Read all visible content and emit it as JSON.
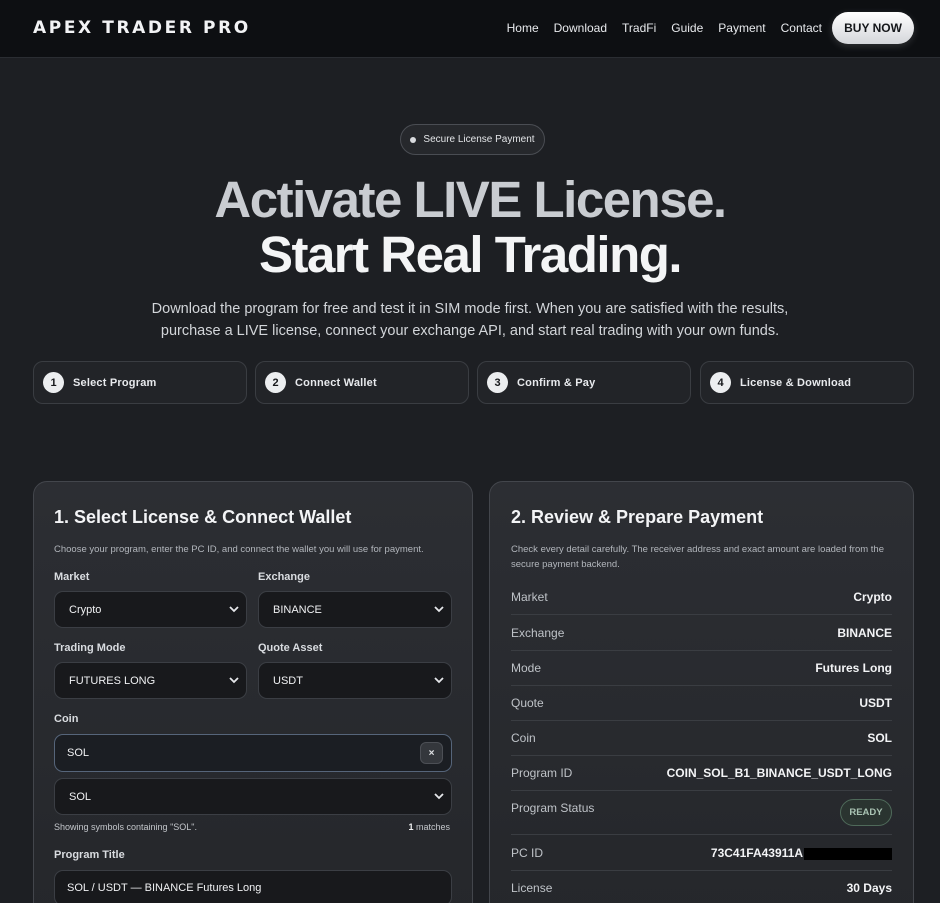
{
  "nav": {
    "brand": "APEX TRADER PRO",
    "links": [
      "Home",
      "Download",
      "TradFi",
      "Guide",
      "Payment",
      "Contact"
    ],
    "buy_label": "BUY NOW"
  },
  "hero": {
    "pill": "Secure License Payment",
    "title_line1": "Activate LIVE License.",
    "title_line2": "Start Real Trading.",
    "description": "Download the program for free and test it in SIM mode first. When you are satisfied with the results, purchase a LIVE license, connect your exchange API, and start real trading with your own funds."
  },
  "steps": [
    {
      "num": "1",
      "label": "Select Program"
    },
    {
      "num": "2",
      "label": "Connect Wallet"
    },
    {
      "num": "3",
      "label": "Confirm & Pay"
    },
    {
      "num": "4",
      "label": "License & Download"
    }
  ],
  "left_card": {
    "title": "1. Select License & Connect Wallet",
    "subtitle": "Choose your program, enter the PC ID, and connect the wallet you will use for payment.",
    "market_label": "Market",
    "market_value": "Crypto",
    "exchange_label": "Exchange",
    "exchange_value": "BINANCE",
    "mode_label": "Trading Mode",
    "mode_value": "FUTURES LONG",
    "quote_label": "Quote Asset",
    "quote_value": "USDT",
    "coin_label": "Coin",
    "coin_search": "SOL",
    "clear_symbol": "×",
    "coin_select": "SOL",
    "hint": "Showing symbols containing \"SOL\".",
    "match_count": "1",
    "match_word": " matches",
    "program_title_label": "Program Title",
    "program_title_value": "SOL / USDT — BINANCE Futures Long"
  },
  "right_card": {
    "title": "2. Review & Prepare Payment",
    "subtitle": "Check every detail carefully. The receiver address and exact amount are loaded from the secure payment backend.",
    "rows": [
      {
        "key": "Market",
        "value": "Crypto"
      },
      {
        "key": "Exchange",
        "value": "BINANCE"
      },
      {
        "key": "Mode",
        "value": "Futures Long"
      },
      {
        "key": "Quote",
        "value": "USDT"
      },
      {
        "key": "Coin",
        "value": "SOL"
      },
      {
        "key": "Program ID",
        "value": "COIN_SOL_B1_BINANCE_USDT_LONG"
      },
      {
        "key": "Program Status",
        "value": "READY"
      },
      {
        "key": "PC ID",
        "value": "73C41FA43911A"
      },
      {
        "key": "License",
        "value": "30 Days"
      }
    ]
  }
}
